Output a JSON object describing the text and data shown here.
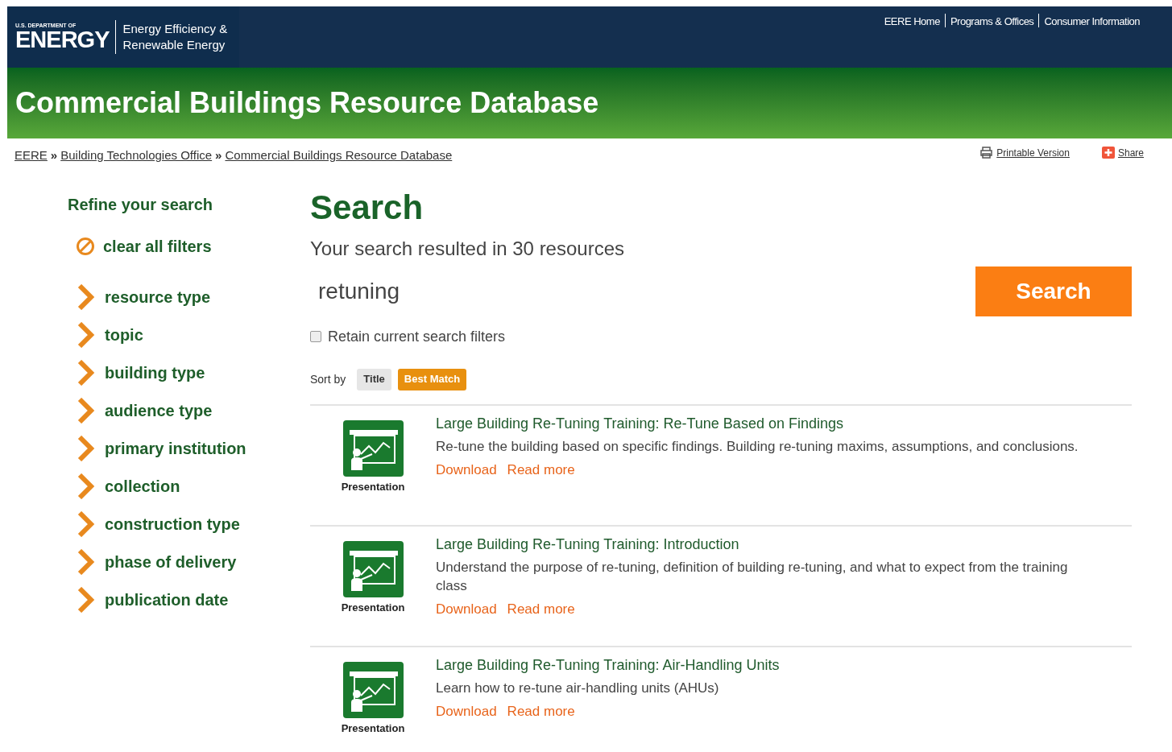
{
  "header": {
    "agency_small": "U.S. DEPARTMENT OF",
    "agency": "ENERGY",
    "office_line_1": "Energy Efficiency &",
    "office_line_2": "Renewable Energy",
    "top_links": [
      "EERE Home",
      "Programs & Offices",
      "Consumer Information"
    ]
  },
  "banner": {
    "title": "Commercial Buildings Resource Database"
  },
  "breadcrumb": [
    "EERE",
    "Building Technologies Office",
    "Commercial Buildings Resource Database"
  ],
  "breadcrumb_separator": "»",
  "page_tools": {
    "print": "Printable Version",
    "share": "Share"
  },
  "sidebar": {
    "title": "Refine your search",
    "clear": "clear all filters",
    "filters": [
      "resource type",
      "topic",
      "building type",
      "audience type",
      "primary institution",
      "collection",
      "construction type",
      "phase of delivery",
      "publication date"
    ]
  },
  "main": {
    "title": "Search",
    "summary": "Your search resulted in 30 resources",
    "query": "retuning",
    "search_button": "Search",
    "retain": {
      "label": "Retain current search filters",
      "checked": false
    },
    "sort_label": "Sort by",
    "sort_options": [
      {
        "label": "Title",
        "selected": false
      },
      {
        "label": "Best Match",
        "selected": true
      }
    ],
    "results": [
      {
        "type": "Presentation",
        "title": "Large Building Re-Tuning Training: Re-Tune Based on Findings",
        "description": "Re-tune the building based on specific findings. Building re-tuning maxims, assumptions, and conclusions.",
        "links": [
          "Download",
          "Read more"
        ]
      },
      {
        "type": "Presentation",
        "title": "Large Building Re-Tuning Training: Introduction",
        "description": "Understand the purpose of re-tuning, definition of building re-tuning, and what to expect from the training class",
        "links": [
          "Download",
          "Read more"
        ]
      },
      {
        "type": "Presentation",
        "title": "Large Building Re-Tuning Training: Air-Handling Units",
        "description": "Learn how to re-tune air-handling units (AHUs)",
        "links": [
          "Download",
          "Read more"
        ]
      }
    ]
  }
}
